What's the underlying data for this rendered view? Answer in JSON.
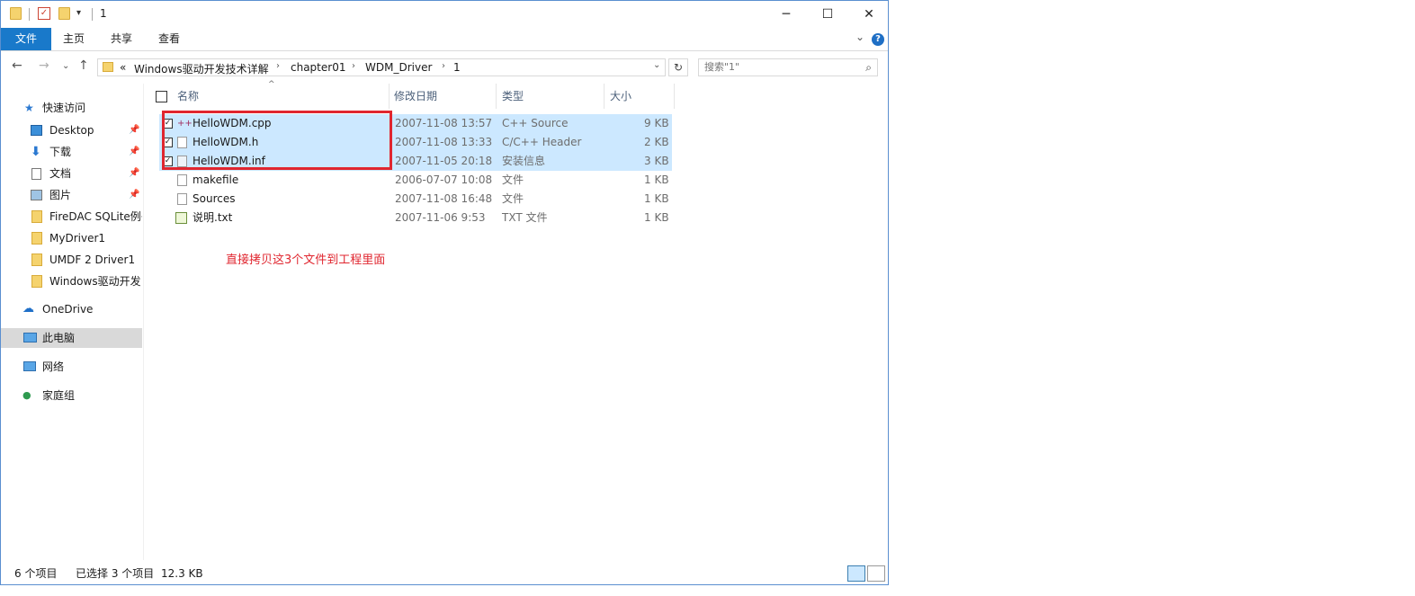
{
  "window": {
    "title": "1"
  },
  "ribbon": {
    "tabs": [
      "文件",
      "主页",
      "共享",
      "查看"
    ]
  },
  "nav": {
    "path": [
      "Windows驱动开发技术详解",
      "chapter01",
      "WDM_Driver",
      "1"
    ],
    "overflow": "«",
    "search_placeholder": "搜索\"1\""
  },
  "sidebar": {
    "quick_access": "快速访问",
    "items": [
      {
        "label": "Desktop",
        "icon": "desktop-icon",
        "pinned": true
      },
      {
        "label": "下载",
        "icon": "download-icon",
        "pinned": true
      },
      {
        "label": "文档",
        "icon": "document-icon",
        "pinned": true
      },
      {
        "label": "图片",
        "icon": "pictures-icon",
        "pinned": true
      },
      {
        "label": "FireDAC SQLite例子",
        "icon": "folder-icon",
        "pinned": false
      },
      {
        "label": "MyDriver1",
        "icon": "folder-icon",
        "pinned": false
      },
      {
        "label": "UMDF 2 Driver1",
        "icon": "folder-icon",
        "pinned": false
      },
      {
        "label": "Windows驱动开发",
        "icon": "folder-icon",
        "pinned": false
      }
    ],
    "onedrive": "OneDrive",
    "this_pc": "此电脑",
    "network": "网络",
    "homegroup": "家庭组"
  },
  "columns": {
    "name": "名称",
    "date": "修改日期",
    "type": "类型",
    "size": "大小"
  },
  "files": [
    {
      "name": "HelloWDM.cpp",
      "date": "2007-11-08 13:57",
      "type": "C++ Source",
      "size": "9 KB",
      "selected": true
    },
    {
      "name": "HelloWDM.h",
      "date": "2007-11-08 13:33",
      "type": "C/C++ Header",
      "size": "2 KB",
      "selected": true
    },
    {
      "name": "HelloWDM.inf",
      "date": "2007-11-05 20:18",
      "type": "安装信息",
      "size": "3 KB",
      "selected": true
    },
    {
      "name": "makefile",
      "date": "2006-07-07 10:08",
      "type": "文件",
      "size": "1 KB",
      "selected": false
    },
    {
      "name": "Sources",
      "date": "2007-11-08 16:48",
      "type": "文件",
      "size": "1 KB",
      "selected": false
    },
    {
      "name": "说明.txt",
      "date": "2007-11-06 9:53",
      "type": "TXT 文件",
      "size": "1 KB",
      "selected": false
    }
  ],
  "annotation": "直接拷贝这3个文件到工程里面",
  "status": {
    "count": "6 个项目",
    "selected": "已选择 3 个项目",
    "size": "12.3 KB"
  },
  "colors": {
    "accent": "#1979ca",
    "selection": "#cce8ff",
    "annotation": "#e0262f"
  }
}
